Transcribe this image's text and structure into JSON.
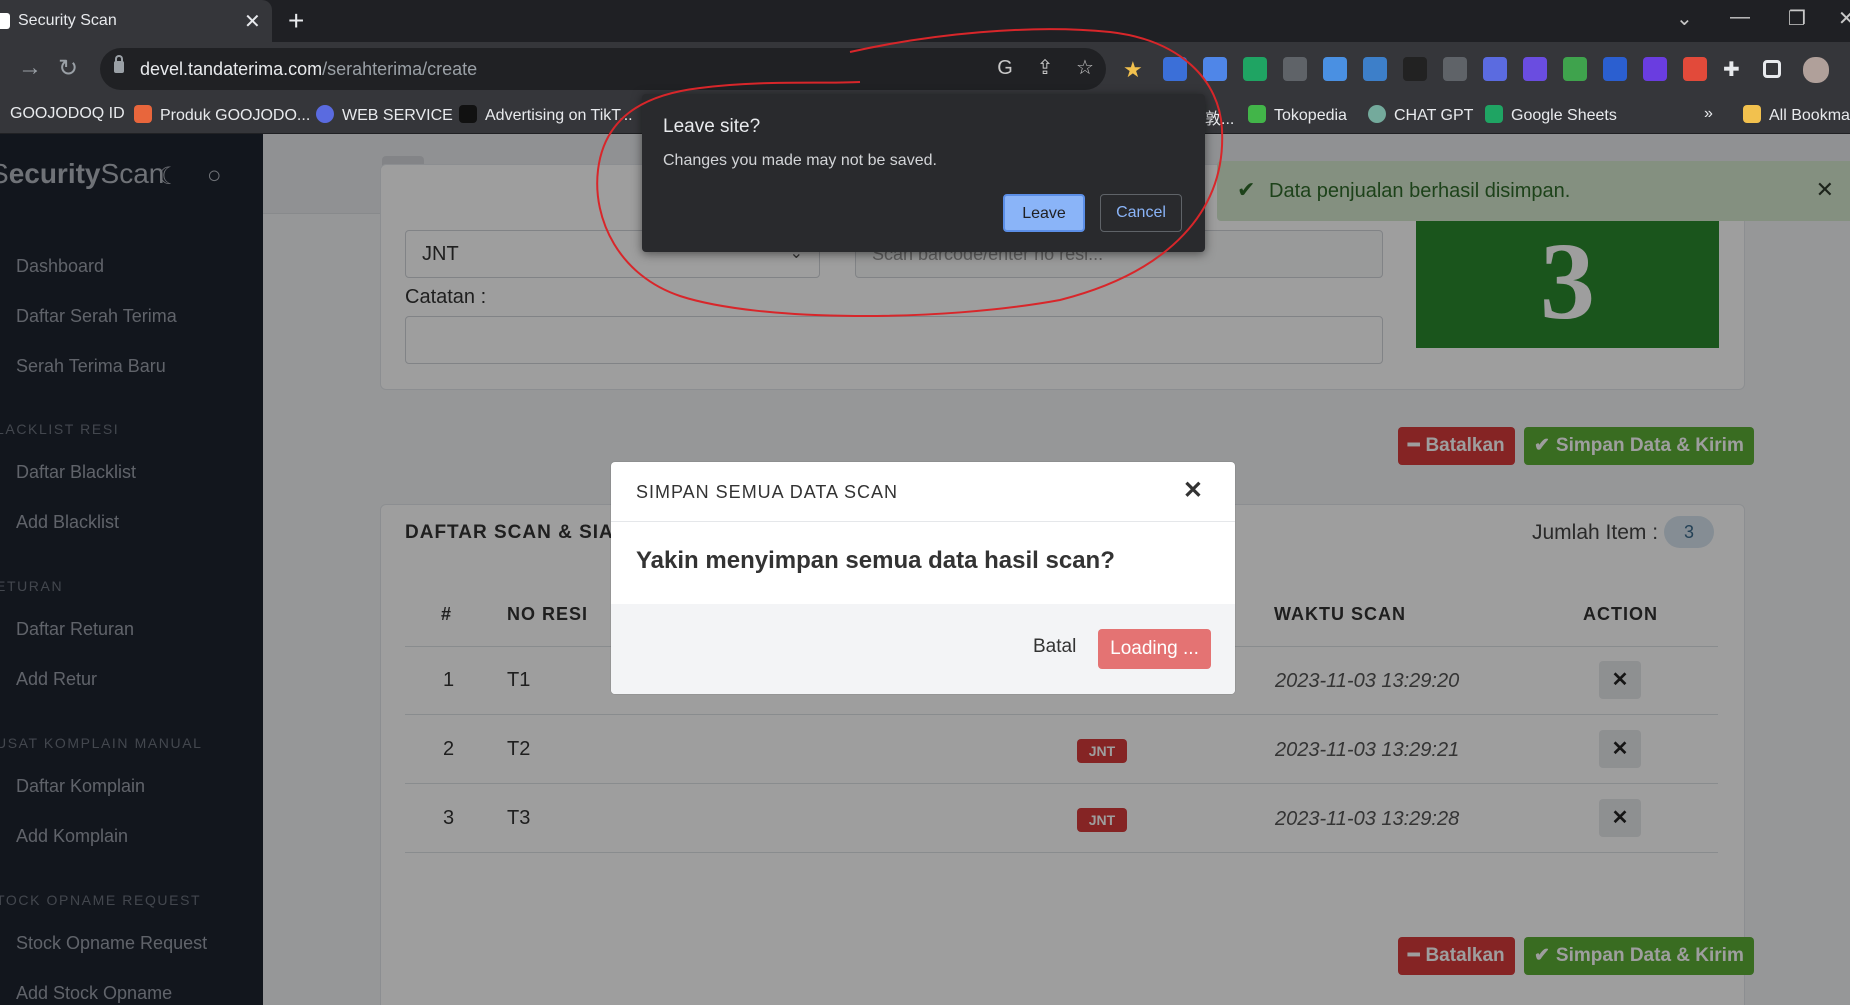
{
  "browser": {
    "tab_title": "Security Scan",
    "url_host": "devel.tandaterima.com",
    "url_path": "/serahterima/create",
    "bookmarks": [
      {
        "label": "GOOJODOQ ID",
        "color": "#35363a"
      },
      {
        "label": "Produk GOOJODO...",
        "color": "#e8663c"
      },
      {
        "label": "WEB SERVICE",
        "color": "#5a6be0"
      },
      {
        "label": "Advertising on TikT...",
        "color": "#111111"
      },
      {
        "label": "敦...",
        "color": "#35363a"
      },
      {
        "label": "Tokopedia",
        "color": "#42b549"
      },
      {
        "label": "CHAT GPT",
        "color": "#74aa9c"
      },
      {
        "label": "Google Sheets",
        "color": "#1fa463"
      },
      {
        "label": "»",
        "color": "#35363a"
      },
      {
        "label": "All Bookmarks",
        "color": "#f2c14e"
      }
    ]
  },
  "sidebar": {
    "brand_light": "ecurity",
    "brand_bold": "Scan",
    "brand_prefix": "S",
    "items": [
      {
        "label": "Dashboard"
      },
      {
        "label": "Daftar Serah Terima"
      },
      {
        "label": "Serah Terima Baru"
      },
      {
        "label": "Daftar Blacklist"
      },
      {
        "label": "Add Blacklist"
      },
      {
        "label": "Daftar Returan"
      },
      {
        "label": "Add Retur"
      },
      {
        "label": "Daftar Komplain"
      },
      {
        "label": "Add Komplain"
      },
      {
        "label": "Stock Opname Request"
      },
      {
        "label": "Add Stock Opname"
      }
    ],
    "headers": [
      "LACKLIST RESI",
      "ETURAN",
      "USAT KOMPLAIN MANUAL",
      "TOCK OPNAME REQUEST"
    ]
  },
  "form": {
    "courier": "JNT",
    "scan_placeholder": "Scan barcode/enter no resi...",
    "catatan_label": "Catatan :",
    "counter": "3"
  },
  "toast": {
    "message": "Data penjualan berhasil disimpan."
  },
  "actions": {
    "cancel": "Batalkan",
    "submit": "Simpan Data & Kirim"
  },
  "list": {
    "title": "DAFTAR SCAN & SIAP",
    "jumlah_label": "Jumlah Item :",
    "jumlah_value": "3",
    "headers": {
      "num": "#",
      "resi": "NO RESI",
      "time": "WAKTU SCAN",
      "action": "ACTION"
    },
    "rows": [
      {
        "num": "1",
        "resi": "T1",
        "courier": "",
        "time": "2023-11-03 13:29:20"
      },
      {
        "num": "2",
        "resi": "T2",
        "courier": "JNT",
        "time": "2023-11-03 13:29:21"
      },
      {
        "num": "3",
        "resi": "T3",
        "courier": "JNT",
        "time": "2023-11-03 13:29:28"
      }
    ]
  },
  "modal": {
    "title": "SIMPAN SEMUA DATA SCAN",
    "question": "Yakin menyimpan semua data hasil scan?",
    "cancel": "Batal",
    "confirm": "Loading ..."
  },
  "leave_dialog": {
    "title": "Leave site?",
    "message": "Changes you made may not be saved.",
    "leave": "Leave",
    "cancel": "Cancel"
  }
}
